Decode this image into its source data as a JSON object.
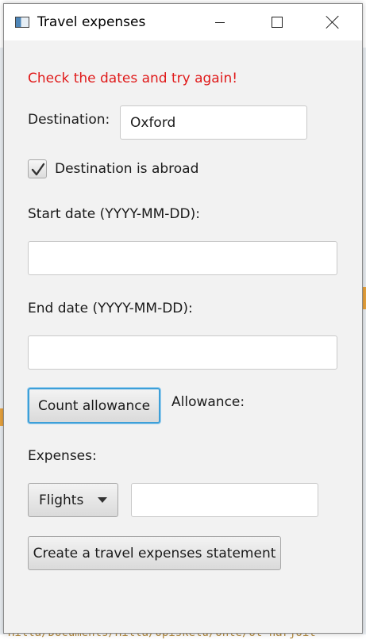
{
  "window": {
    "title": "Travel expenses"
  },
  "form": {
    "error_message": "Check the dates and try again!",
    "destination_label": "Destination:",
    "destination_value": "Oxford",
    "abroad_label": "Destination is abroad",
    "abroad_checked": true,
    "start_date_label": "Start date (YYYY-MM-DD):",
    "start_date_value": "",
    "end_date_label": "End date (YYYY-MM-DD):",
    "end_date_value": "",
    "count_button_label": "Count allowance",
    "allowance_label": "Allowance:",
    "expenses_label": "Expenses:",
    "expense_type_selected": "Flights",
    "expense_amount_value": "",
    "create_button_label": "Create a travel expenses statement"
  },
  "background": {
    "path_text": "Hilla/Documents/Hilla/Opiskelu/Ohte/ot-harjoit"
  },
  "colors": {
    "error": "#e01b1b",
    "focus_ring": "#3d9fd8",
    "window_bg": "#f2f2f2"
  }
}
